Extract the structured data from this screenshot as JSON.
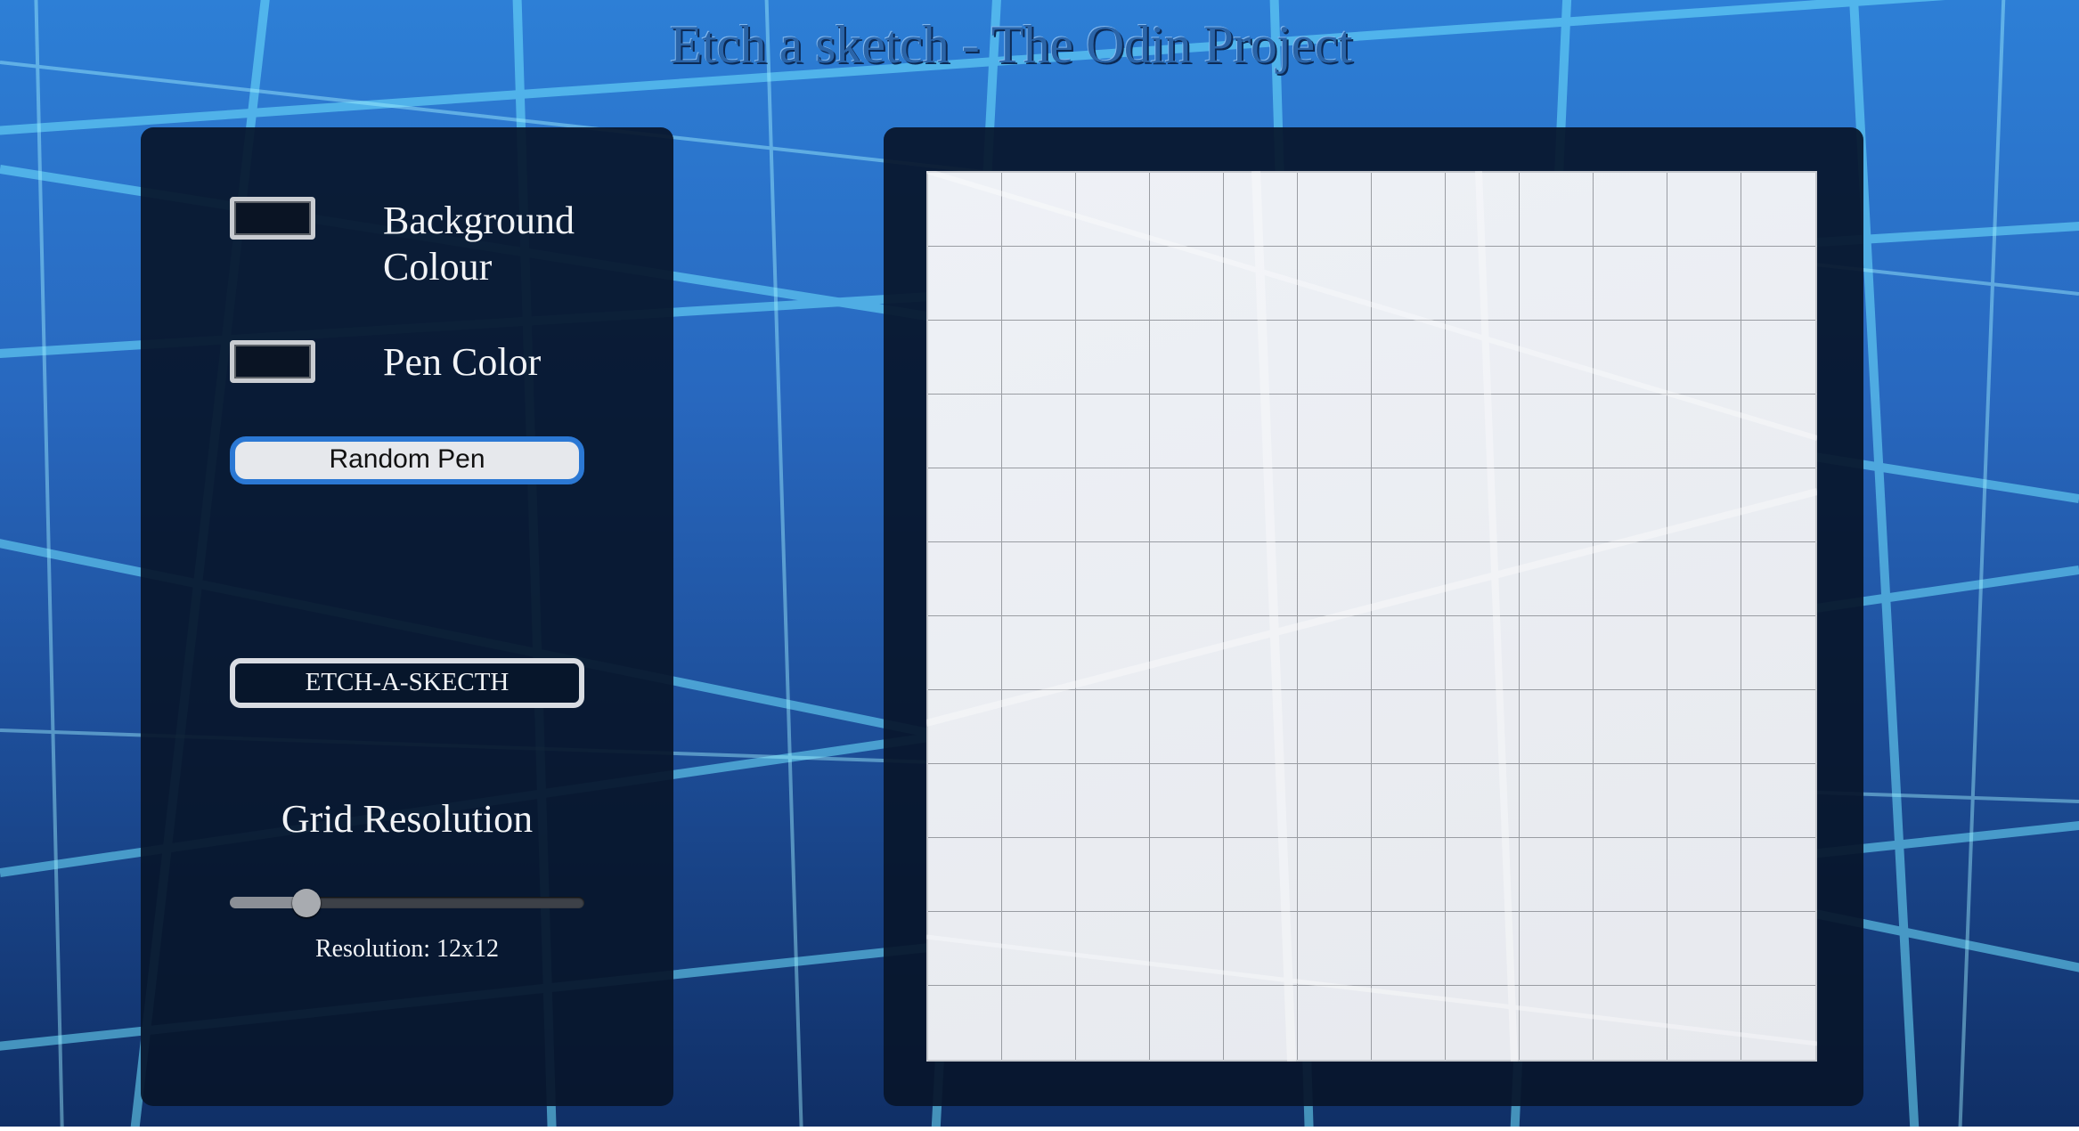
{
  "page": {
    "title": "Etch a sketch - The Odin Project"
  },
  "controls": {
    "background": {
      "label": "Background Colour",
      "label_line1": "Background",
      "label_line2": "Colour",
      "value": "#0a1424"
    },
    "pen": {
      "label": "Pen Color",
      "value": "#0a1424"
    },
    "random_pen_label": "Random Pen",
    "etch_button_label": "ETCH-A-SKECTH",
    "grid_resolution_heading": "Grid Resolution",
    "slider": {
      "min": 2,
      "max": 64,
      "value": 12
    },
    "resolution_text": "Resolution: 12x12"
  },
  "grid": {
    "rows": 12,
    "columns": 12,
    "cell_color": "#eceef2"
  },
  "colors": {
    "accent": "#2b78d4",
    "panel": "#07162b"
  }
}
